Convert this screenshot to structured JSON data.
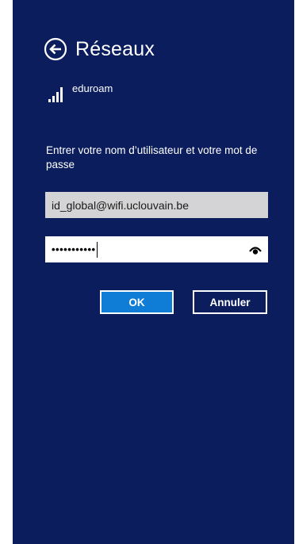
{
  "header": {
    "title": "Réseaux",
    "back_icon": "back-arrow-circle-icon"
  },
  "network": {
    "name": "eduroam",
    "signal_icon": "wifi-signal-bars-icon",
    "signal_bars": 4
  },
  "login": {
    "prompt": "Entrer votre nom d’utilisateur et votre mot de passe",
    "username_value": "id_global@wifi.uclouvain.be",
    "password_mask": "•••••••••••",
    "reveal_icon": "reveal-password-eye-icon"
  },
  "buttons": {
    "ok_label": "OK",
    "cancel_label": "Annuler"
  },
  "colors": {
    "panel_background": "#0b1d5c",
    "username_field_background": "#d4d4d6",
    "ok_button_background": "#0f7dd6"
  }
}
